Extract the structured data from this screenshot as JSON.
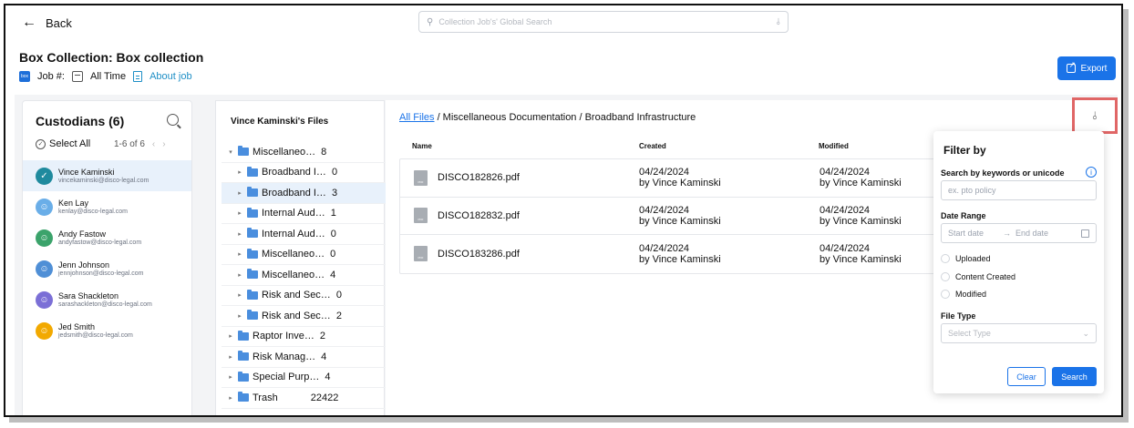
{
  "header": {
    "back_label": "Back",
    "search_placeholder": "Collection Job's' Global Search",
    "title": "Box Collection: Box collection",
    "job_label": "Job #:",
    "time_label": "All Time",
    "about_label": "About job",
    "export_label": "Export",
    "box_logo_text": "box"
  },
  "custodians": {
    "title": "Custodians (6)",
    "select_all": "Select All",
    "pagination": "1-6 of 6",
    "items": [
      {
        "name": "Vince Kaminski",
        "email": "vincekaminski@disco-legal.com",
        "color": "#1f8a9e",
        "selected": true
      },
      {
        "name": "Ken Lay",
        "email": "kenlay@disco-legal.com",
        "color": "#6aaee8",
        "selected": false
      },
      {
        "name": "Andy Fastow",
        "email": "andyfastow@disco-legal.com",
        "color": "#3ba36b",
        "selected": false
      },
      {
        "name": "Jenn Johnson",
        "email": "jennjohnson@disco-legal.com",
        "color": "#4f8fd6",
        "selected": false
      },
      {
        "name": "Sara Shackleton",
        "email": "sarashackleton@disco-legal.com",
        "color": "#7b6fd6",
        "selected": false
      },
      {
        "name": "Jed Smith",
        "email": "jedsmith@disco-legal.com",
        "color": "#f2a900",
        "selected": false
      }
    ]
  },
  "tree": {
    "title": "Vince Kaminski's Files",
    "nodes": [
      {
        "label": "Miscellaneo…",
        "count": "8",
        "level": 0,
        "expanded": true,
        "selected": false
      },
      {
        "label": "Broadband I…",
        "count": "0",
        "level": 1,
        "expanded": false,
        "selected": false
      },
      {
        "label": "Broadband I…",
        "count": "3",
        "level": 1,
        "expanded": false,
        "selected": true
      },
      {
        "label": "Internal Aud…",
        "count": "1",
        "level": 1,
        "expanded": false,
        "selected": false
      },
      {
        "label": "Internal Aud…",
        "count": "0",
        "level": 1,
        "expanded": false,
        "selected": false
      },
      {
        "label": "Miscellaneo…",
        "count": "0",
        "level": 1,
        "expanded": false,
        "selected": false
      },
      {
        "label": "Miscellaneo…",
        "count": "4",
        "level": 1,
        "expanded": false,
        "selected": false
      },
      {
        "label": "Risk and Sec…",
        "count": "0",
        "level": 1,
        "expanded": false,
        "selected": false
      },
      {
        "label": "Risk and Sec…",
        "count": "2",
        "level": 1,
        "expanded": false,
        "selected": false
      },
      {
        "label": "Raptor Inve…",
        "count": "2",
        "level": 0,
        "expanded": false,
        "selected": false
      },
      {
        "label": "Risk Manag…",
        "count": "4",
        "level": 0,
        "expanded": false,
        "selected": false
      },
      {
        "label": "Special Purp…",
        "count": "4",
        "level": 0,
        "expanded": false,
        "selected": false
      },
      {
        "label": "Trash",
        "count": "22422",
        "level": 0,
        "expanded": false,
        "selected": false
      }
    ]
  },
  "files": {
    "breadcrumb_root": "All Files",
    "breadcrumb_path": " / Miscellaneous Documentation / Broadband Infrastructure",
    "columns": {
      "name": "Name",
      "created": "Created",
      "modified": "Modified"
    },
    "rows": [
      {
        "name": "DISCO182826.pdf",
        "created_date": "04/24/2024",
        "created_by": "by Vince Kaminski",
        "modified_date": "04/24/2024",
        "modified_by": "by Vince Kaminski"
      },
      {
        "name": "DISCO182832.pdf",
        "created_date": "04/24/2024",
        "created_by": "by Vince Kaminski",
        "modified_date": "04/24/2024",
        "modified_by": "by Vince Kaminski"
      },
      {
        "name": "DISCO183286.pdf",
        "created_date": "04/24/2024",
        "created_by": "by Vince Kaminski",
        "modified_date": "04/24/2024",
        "modified_by": "by Vince Kaminski"
      }
    ],
    "file_icon_text": "PDF"
  },
  "filter": {
    "title": "Filter by",
    "keyword_label": "Search by keywords or unicode",
    "keyword_placeholder": "ex. pto policy",
    "date_range_label": "Date Range",
    "start_date_placeholder": "Start date",
    "end_date_placeholder": "End date",
    "date_options": [
      "Uploaded",
      "Content Created",
      "Modified"
    ],
    "file_type_label": "File Type",
    "file_type_placeholder": "Select Type",
    "clear_label": "Clear",
    "search_label": "Search"
  },
  "colors": {
    "accent": "#1a73e8",
    "highlight_border": "#e06666",
    "selected_row": "#e8f1fb",
    "folder": "#4a8ede"
  }
}
